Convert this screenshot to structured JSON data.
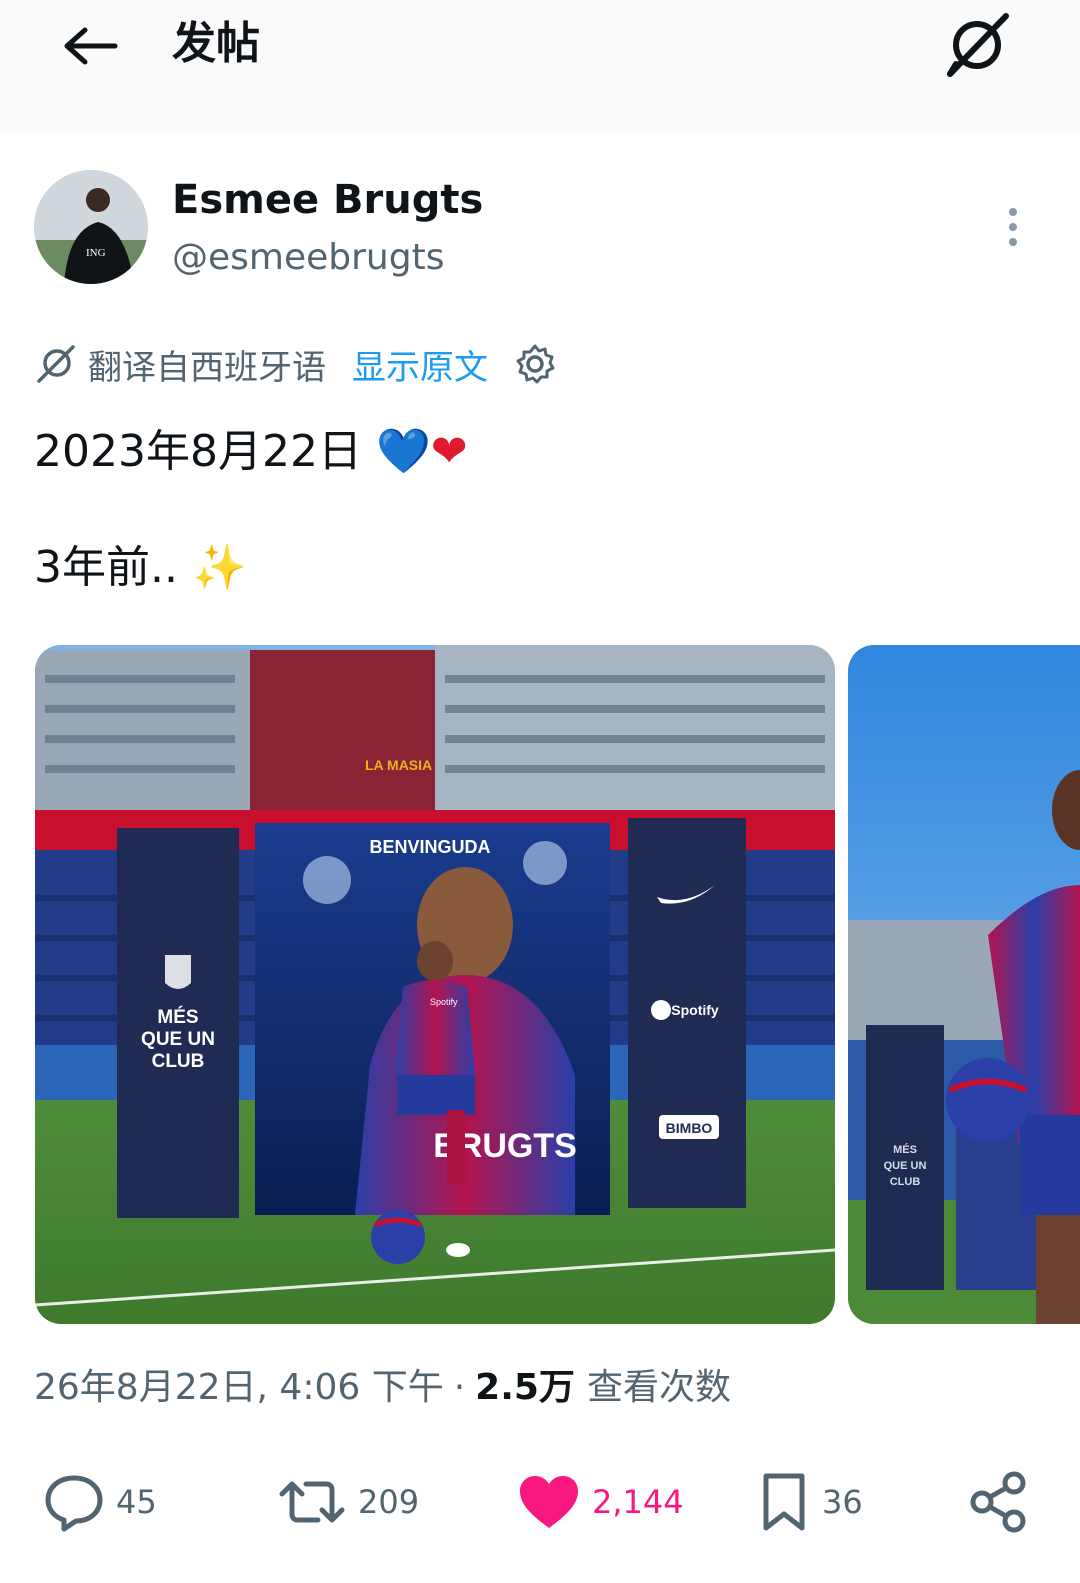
{
  "header": {
    "title": "发帖",
    "back_icon": "arrow-left-icon",
    "translate_icon": "translate-slash-icon"
  },
  "author": {
    "name": "Esmee Brugts",
    "handle": "@esmeebrugts",
    "avatar_text": "ING"
  },
  "translation": {
    "label": "翻译自西班牙语",
    "show_original": "显示原文",
    "link_color": "#1d9bf0"
  },
  "tweet": {
    "line1_text": "2023年8月22日",
    "line1_emoji": [
      "💙",
      "❤"
    ],
    "line2_text": "3年前..",
    "line2_emoji": "✨"
  },
  "media": {
    "main": {
      "banner_title": "BENVINGUDA",
      "left_panel": [
        "MÉS",
        "QUE UN",
        "CLUB"
      ],
      "right_panel": [
        "Spotify",
        "BIMBO"
      ],
      "poster_text": "BRUGTS",
      "jersey_sponsor": "Spotify",
      "building_sign": "LA MASIA"
    },
    "second": {
      "panel_text": [
        "MÉS",
        "QUE UN",
        "CLUB"
      ]
    }
  },
  "meta": {
    "date_time": "26年8月22日, 4:06 下午",
    "separator": "·",
    "views_count": "2.5万",
    "views_label": "查看次数"
  },
  "actions": {
    "replies": "45",
    "retweets": "209",
    "likes": "2,144",
    "bookmarks": "36",
    "like_color": "#f91880",
    "muted_color": "#536471"
  }
}
